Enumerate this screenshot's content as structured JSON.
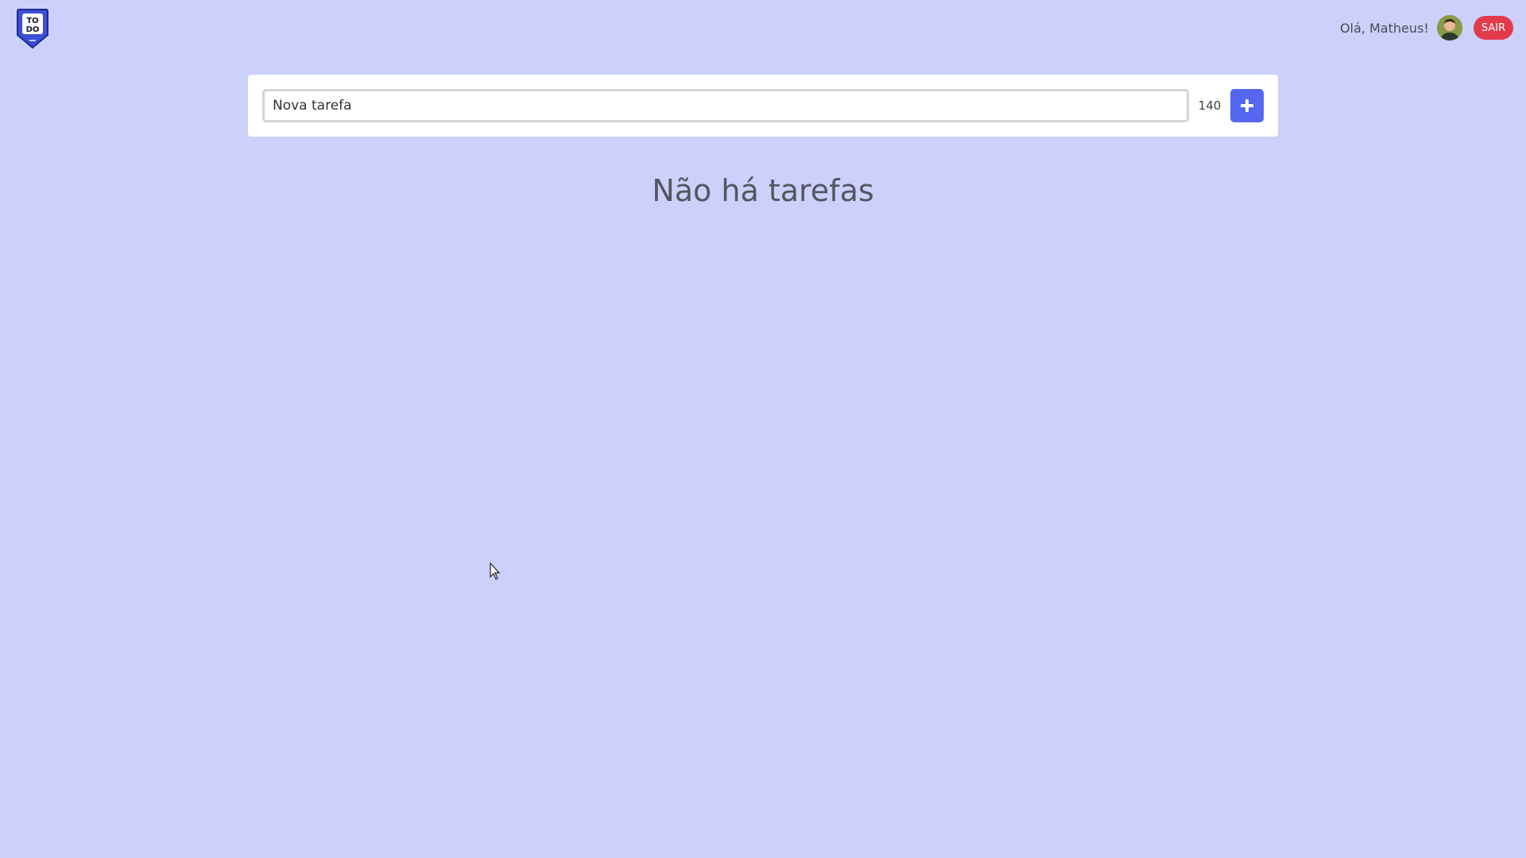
{
  "app": {
    "logo_text_line1": "TO",
    "logo_text_line2": "DO",
    "logo_icon": "todo-shield-icon"
  },
  "header": {
    "greeting": "Olá, Matheus!",
    "logout_label": "SAIR",
    "avatar_icon": "user-avatar"
  },
  "task_form": {
    "input_value": "Nova tarefa",
    "input_placeholder": "Nova tarefa",
    "char_remaining": "140",
    "add_icon": "plus-icon"
  },
  "task_list": {
    "empty_message": "Não há tarefas"
  },
  "colors": {
    "background": "#cbd1fb",
    "accent": "#5566f0",
    "logout": "#e33a4a",
    "logo": "#3b4fd8"
  }
}
